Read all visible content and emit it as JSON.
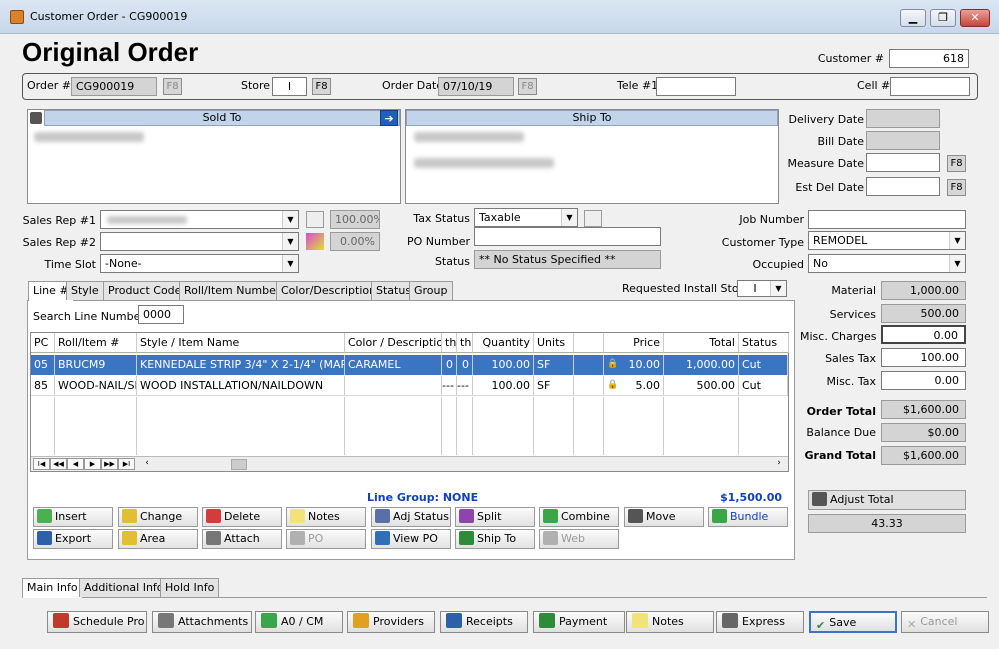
{
  "window": {
    "title": "Customer Order - CG900019",
    "min": "▁",
    "max": "❐",
    "close": "✕"
  },
  "page": {
    "heading": "Original Order"
  },
  "header": {
    "customer_label": "Customer #",
    "customer_value": "618",
    "order_label": "Order #",
    "order_value": "CG900019",
    "store_label": "Store",
    "store_value": "I",
    "order_date_label": "Order Date",
    "order_date_value": "07/10/19",
    "tele_label": "Tele #1",
    "tele_value": "",
    "cell_label": "Cell #",
    "cell_value": "",
    "f8": "F8"
  },
  "sold_to": {
    "label": "Sold To"
  },
  "ship_to": {
    "label": "Ship To"
  },
  "dates": {
    "delivery_label": "Delivery Date",
    "bill_label": "Bill Date",
    "measure_label": "Measure Date",
    "est_del_label": "Est Del Date",
    "f8": "F8"
  },
  "sales": {
    "rep1_label": "Sales Rep #1",
    "rep1_pct": "100.00%",
    "rep2_label": "Sales Rep #2",
    "rep2_pct": "0.00%",
    "timeslot_label": "Time Slot",
    "timeslot_value": "-None-"
  },
  "tax": {
    "tax_status_label": "Tax Status",
    "tax_status_value": "Taxable",
    "po_label": "PO Number",
    "po_value": "",
    "status_label": "Status",
    "status_value": "** No Status Specified **"
  },
  "job": {
    "job_number_label": "Job Number",
    "job_number_value": "",
    "customer_type_label": "Customer Type",
    "customer_type_value": "REMODEL",
    "occupied_label": "Occupied",
    "occupied_value": "No"
  },
  "tabs": [
    "Line #",
    "Style",
    "Product Code",
    "Roll/Item Number",
    "Color/Description",
    "Status",
    "Group"
  ],
  "requested_install": {
    "label": "Requested Install Store",
    "value": "I"
  },
  "search": {
    "label": "Search Line Number",
    "value": "0000"
  },
  "grid": {
    "columns": [
      "PC",
      "Roll/Item #",
      "Style / Item Name",
      "Color / Description",
      "th",
      "th",
      "Quantity",
      "Units",
      "",
      "Price",
      "Total",
      "Status"
    ],
    "rows": [
      {
        "pc": "05",
        "roll": "BRUCM9",
        "style": "KENNEDALE STRIP 3/4\" X 2-1/4\" (MAPLE)",
        "color": "CARAMEL",
        "th1": "0",
        "th2": "0",
        "qty": "100.00",
        "units": "SF",
        "price": "10.00",
        "total": "1,000.00",
        "status": "Cut"
      },
      {
        "pc": "85",
        "roll": "WOOD-NAIL/SF",
        "style": "WOOD INSTALLATION/NAILDOWN",
        "color": "",
        "th1": "---",
        "th2": "---",
        "qty": "100.00",
        "units": "SF",
        "price": "5.00",
        "total": "500.00",
        "status": "Cut"
      }
    ],
    "nav": [
      "I◀",
      "◀◀",
      "◀",
      "▶",
      "▶▶",
      "▶I"
    ]
  },
  "line_group": {
    "label": "Line Group: NONE",
    "total": "$1,500.00"
  },
  "actions": [
    {
      "label": "Insert",
      "color": "#4caf50"
    },
    {
      "label": "Change",
      "color": "#e0c030"
    },
    {
      "label": "Delete",
      "color": "#d23c3c"
    },
    {
      "label": "Notes",
      "color": "#f2e27a"
    },
    {
      "label": "Adj Status",
      "color": "#5a6fa8"
    },
    {
      "label": "Split",
      "color": "#8e44ad"
    },
    {
      "label": "Combine",
      "color": "#3aa64a"
    },
    {
      "label": "Move",
      "color": "#555555"
    },
    {
      "label": "Bundle",
      "color": "#3aa64a"
    },
    {
      "label": "Export",
      "color": "#2f5fa8"
    },
    {
      "label": "Area",
      "color": "#e0c030"
    },
    {
      "label": "Attach",
      "color": "#777777"
    },
    {
      "label": "PO",
      "color": "#b0b0b0"
    },
    {
      "label": "View PO",
      "color": "#2f6fb8"
    },
    {
      "label": "Ship To",
      "color": "#2e8b3a"
    },
    {
      "label": "Web",
      "color": "#b0b0b0"
    }
  ],
  "totals": {
    "material_label": "Material",
    "material": "1,000.00",
    "services_label": "Services",
    "services": "500.00",
    "misc_charges_label": "Misc. Charges",
    "misc_charges": "0.00",
    "sales_tax_label": "Sales Tax",
    "sales_tax": "100.00",
    "misc_tax_label": "Misc. Tax",
    "misc_tax": "0.00",
    "order_total_label": "Order Total",
    "order_total": "$1,600.00",
    "balance_due_label": "Balance Due",
    "balance_due": "$0.00",
    "grand_total_label": "Grand Total",
    "grand_total": "$1,600.00",
    "adjust_total_label": "Adjust Total",
    "adjust_value": "43.33"
  },
  "bottom_tabs": [
    "Main Info",
    "Additional Info",
    "Hold Info"
  ],
  "bottom_buttons": [
    {
      "label": "Schedule Pro",
      "color": "#c0392b"
    },
    {
      "label": "Attachments",
      "color": "#777777"
    },
    {
      "label": "A0 / CM",
      "color": "#3aa64a"
    },
    {
      "label": "Providers",
      "color": "#e0a020"
    },
    {
      "label": "Receipts",
      "color": "#2f5fa8"
    },
    {
      "label": "Payment",
      "color": "#2e8b3a"
    },
    {
      "label": "Notes",
      "color": "#f2e27a"
    },
    {
      "label": "Express",
      "color": "#666666"
    },
    {
      "label": "Save",
      "color": "#2e8b3a"
    },
    {
      "label": "Cancel",
      "color": "#b0b0b0"
    }
  ]
}
